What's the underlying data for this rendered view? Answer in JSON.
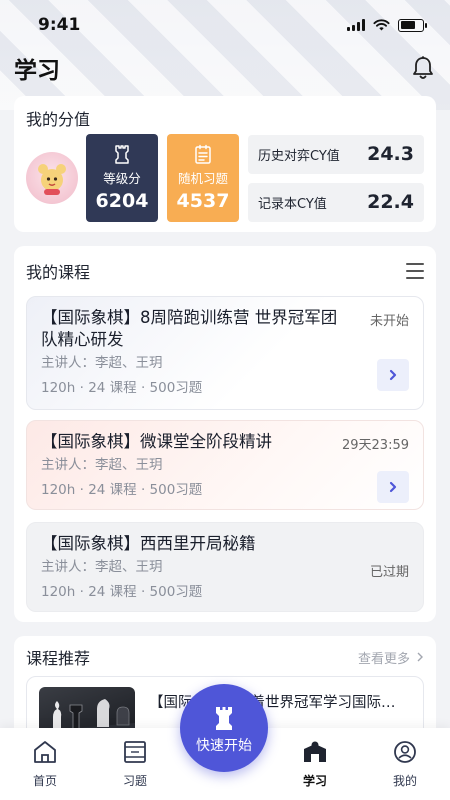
{
  "status_bar": {
    "time": "9:41"
  },
  "header": {
    "title": "学习"
  },
  "score": {
    "title": "我的分值",
    "level": {
      "label": "等级分",
      "value": "6204"
    },
    "random": {
      "label": "随机习题",
      "value": "4537"
    },
    "history_cy": {
      "label": "历史对弈CY值",
      "value": "24.3"
    },
    "record_cy": {
      "label": "记录本CY值",
      "value": "22.4"
    }
  },
  "courses": {
    "title": "我的课程",
    "items": [
      {
        "name": "【国际象棋】8周陪跑训练营 世界冠军团队精心研发",
        "status": "未开始",
        "lecturer": "主讲人：李超、王玥",
        "meta": "120h · 24 课程 · 500习题"
      },
      {
        "name": "【国际象棋】微课堂全阶段精讲",
        "status": "29天23:59",
        "lecturer": "主讲人：李超、王玥",
        "meta": "120h · 24 课程 · 500习题"
      },
      {
        "name": "【国际象棋】西西里开局秘籍",
        "status": "已过期",
        "lecturer": "主讲人：李超、王玥",
        "meta": "120h · 24 课程 · 500习题"
      }
    ]
  },
  "recommend": {
    "title": "课程推荐",
    "more": "查看更多",
    "item": {
      "name": "【国际象棋】跟着世界冠军学习国际象棋"
    }
  },
  "tabbar": {
    "tabs": [
      {
        "label": "首页",
        "icon": "home-icon"
      },
      {
        "label": "习题",
        "icon": "board-icon"
      },
      {
        "label": "学习",
        "icon": "study-icon",
        "active": true
      },
      {
        "label": "我的",
        "icon": "profile-icon"
      }
    ],
    "fab": {
      "label": "快速开始",
      "icon": "chess-pawn-icon"
    }
  },
  "colors": {
    "accent": "#4f56d8",
    "level_tile": "#303956",
    "random_tile": "#f8ad53"
  }
}
